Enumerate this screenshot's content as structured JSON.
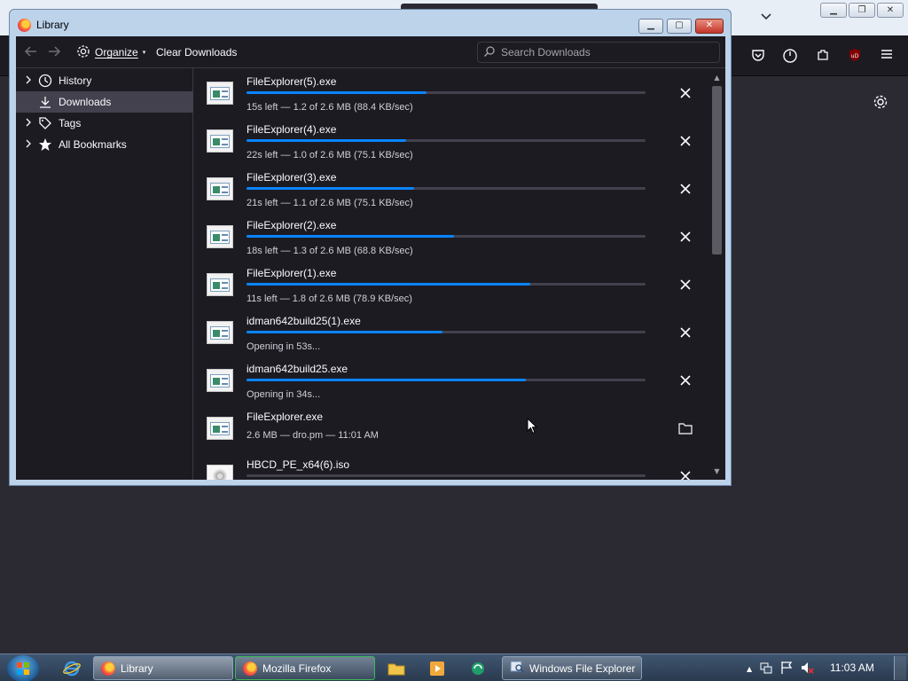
{
  "browser": {
    "chevron_icon": "chevron-down-icon",
    "nav_icons": [
      "pocket-icon",
      "sync-icon",
      "extensions-icon",
      "ublock-icon",
      "menu-icon"
    ],
    "ublock_label": "uD"
  },
  "library": {
    "title": "Library",
    "toolbar": {
      "organize_label": "Organize",
      "clear_label": "Clear Downloads",
      "search_placeholder": "Search Downloads"
    },
    "sidebar": {
      "items": [
        {
          "label": "History"
        },
        {
          "label": "Downloads"
        },
        {
          "label": "Tags"
        },
        {
          "label": "All Bookmarks"
        }
      ]
    },
    "downloads": [
      {
        "name": "FileExplorer(5).exe",
        "status": "15s left — 1.2 of 2.6 MB (88.4 KB/sec)",
        "progress": 0.45,
        "action": "cancel"
      },
      {
        "name": "FileExplorer(4).exe",
        "status": "22s left — 1.0 of 2.6 MB (75.1 KB/sec)",
        "progress": 0.4,
        "action": "cancel"
      },
      {
        "name": "FileExplorer(3).exe",
        "status": "21s left — 1.1 of 2.6 MB (75.1 KB/sec)",
        "progress": 0.42,
        "action": "cancel"
      },
      {
        "name": "FileExplorer(2).exe",
        "status": "18s left — 1.3 of 2.6 MB (68.8 KB/sec)",
        "progress": 0.52,
        "action": "cancel"
      },
      {
        "name": "FileExplorer(1).exe",
        "status": "11s left — 1.8 of 2.6 MB (78.9 KB/sec)",
        "progress": 0.71,
        "action": "cancel"
      },
      {
        "name": "idman642build25(1).exe",
        "status": "Opening in 53s...",
        "progress": 0.49,
        "action": "cancel"
      },
      {
        "name": "idman642build25.exe",
        "status": "Opening in 34s...",
        "progress": 0.7,
        "action": "cancel"
      },
      {
        "name": "FileExplorer.exe",
        "status": "2.6 MB — dro.pm — 11:01 AM",
        "progress": null,
        "action": "folder"
      },
      {
        "name": "HBCD_PE_x64(6).iso",
        "status": "",
        "progress": 0.0,
        "action": "cancel"
      }
    ]
  },
  "taskbar": {
    "tasks": [
      {
        "label": "Library"
      },
      {
        "label": "Mozilla Firefox"
      },
      {
        "label": "Windows File Explorer"
      }
    ],
    "clock": "11:03 AM"
  }
}
